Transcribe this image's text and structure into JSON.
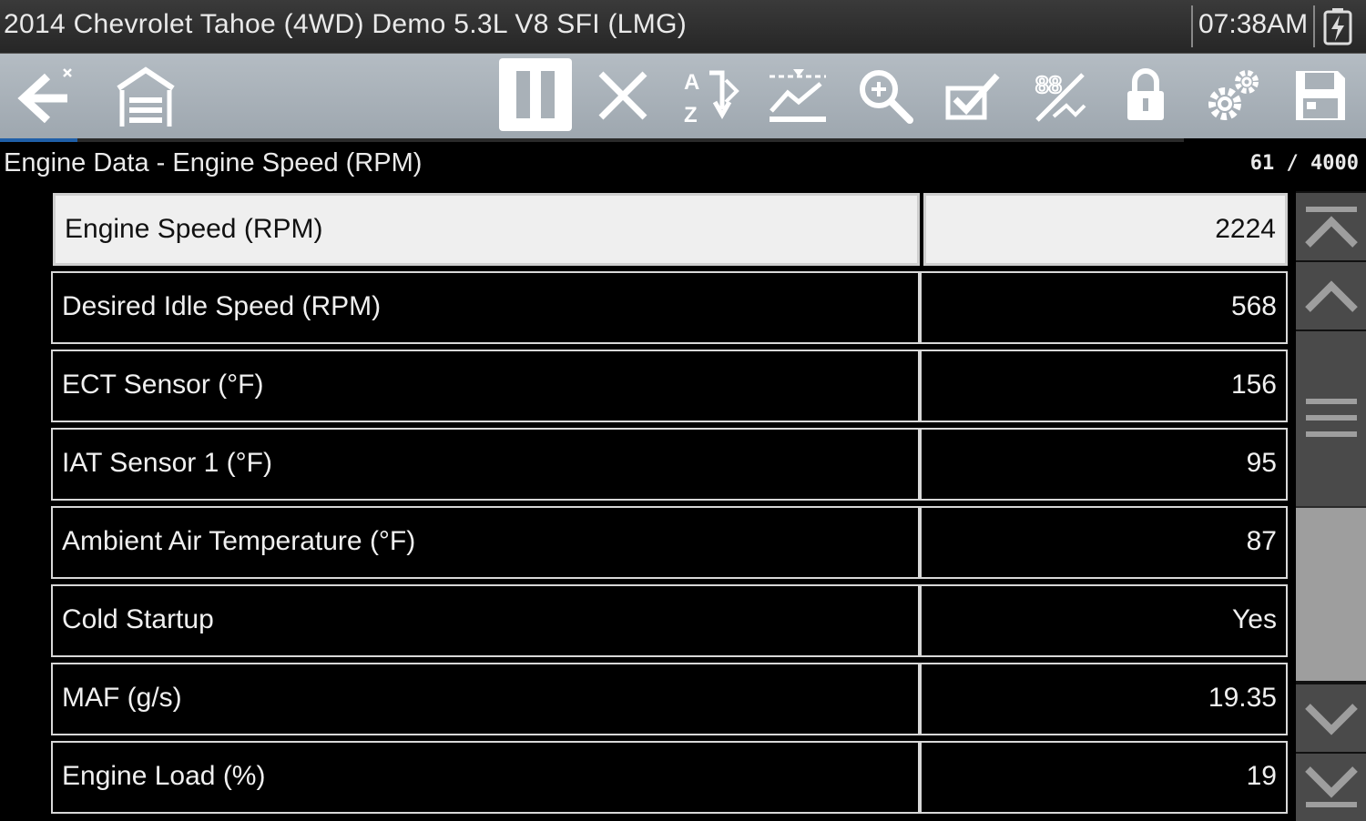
{
  "titlebar": {
    "vehicle": "2014 Chevrolet Tahoe (4WD) Demo 5.3L V8 SFI (LMG)",
    "time": "07:38AM"
  },
  "toolbar": {
    "buttons": [
      {
        "name": "back",
        "icon": "back-arrow-icon"
      },
      {
        "name": "home",
        "icon": "home-garage-icon"
      },
      {
        "name": "pause",
        "icon": "pause-icon",
        "active": true
      },
      {
        "name": "clear",
        "icon": "close-icon"
      },
      {
        "name": "sort",
        "icon": "sort-az-icon"
      },
      {
        "name": "graph",
        "icon": "graph-trigger-icon"
      },
      {
        "name": "zoom",
        "icon": "zoom-icon"
      },
      {
        "name": "select",
        "icon": "checkmark-icon"
      },
      {
        "name": "custom-list",
        "icon": "custom-pid-icon"
      },
      {
        "name": "lock",
        "icon": "lock-icon"
      },
      {
        "name": "settings",
        "icon": "gear-icon"
      },
      {
        "name": "save",
        "icon": "save-icon"
      }
    ],
    "buffer_progress": 0.065
  },
  "screen": {
    "title": "Engine Data - Engine Speed (RPM)",
    "counter": "61 / 4000"
  },
  "rows": [
    {
      "name": "Engine Speed (RPM)",
      "value": "2224",
      "selected": true
    },
    {
      "name": "Desired Idle Speed (RPM)",
      "value": "568"
    },
    {
      "name": "ECT Sensor (°F)",
      "value": "156"
    },
    {
      "name": "IAT Sensor 1 (°F)",
      "value": "95"
    },
    {
      "name": "Ambient Air Temperature (°F)",
      "value": "87"
    },
    {
      "name": "Cold Startup",
      "value": "Yes"
    },
    {
      "name": "MAF (g/s)",
      "value": "19.35"
    },
    {
      "name": "Engine Load (%)",
      "value": "19"
    }
  ],
  "scrollbar": {
    "icons": [
      "scroll-top-icon",
      "scroll-up-icon",
      "grip-icon",
      "scroll-down-icon",
      "scroll-bottom-icon"
    ]
  },
  "colors": {
    "toolbar": "#a9b1b8",
    "selected_row": "#efefef",
    "progress": "#1f5fa8"
  }
}
